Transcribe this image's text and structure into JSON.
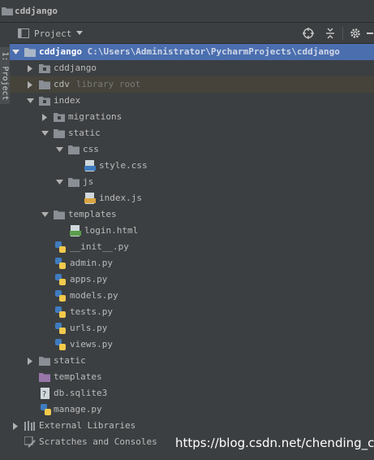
{
  "breadcrumb": "cddjango",
  "side_tab": "1: Project",
  "toolbar": {
    "view_label": "Project"
  },
  "tree": {
    "root": {
      "name": "cddjango",
      "path": "C:\\Users\\Administrator\\PycharmProjects\\cddjango"
    },
    "items": [
      {
        "label": "cddjango"
      },
      {
        "label": "cdv",
        "note": "library root"
      },
      {
        "label": "index"
      },
      {
        "label": "migrations"
      },
      {
        "label": "static"
      },
      {
        "label": "css"
      },
      {
        "label": "style.css"
      },
      {
        "label": "js"
      },
      {
        "label": "index.js"
      },
      {
        "label": "templates"
      },
      {
        "label": "login.html"
      },
      {
        "label": "__init__.py"
      },
      {
        "label": "admin.py"
      },
      {
        "label": "apps.py"
      },
      {
        "label": "models.py"
      },
      {
        "label": "tests.py"
      },
      {
        "label": "urls.py"
      },
      {
        "label": "views.py"
      },
      {
        "label": "static"
      },
      {
        "label": "templates"
      },
      {
        "label": "db.sqlite3"
      },
      {
        "label": "manage.py"
      },
      {
        "label": "External Libraries"
      },
      {
        "label": "Scratches and Consoles"
      }
    ]
  },
  "watermark": "https://blog.csdn.net/chending_cd",
  "colors": {
    "selection": "#4b6eaf",
    "background": "#3c3f41",
    "folder": "#8a8f96",
    "python_blue": "#3f7cbf",
    "python_yellow": "#f2c94c"
  }
}
